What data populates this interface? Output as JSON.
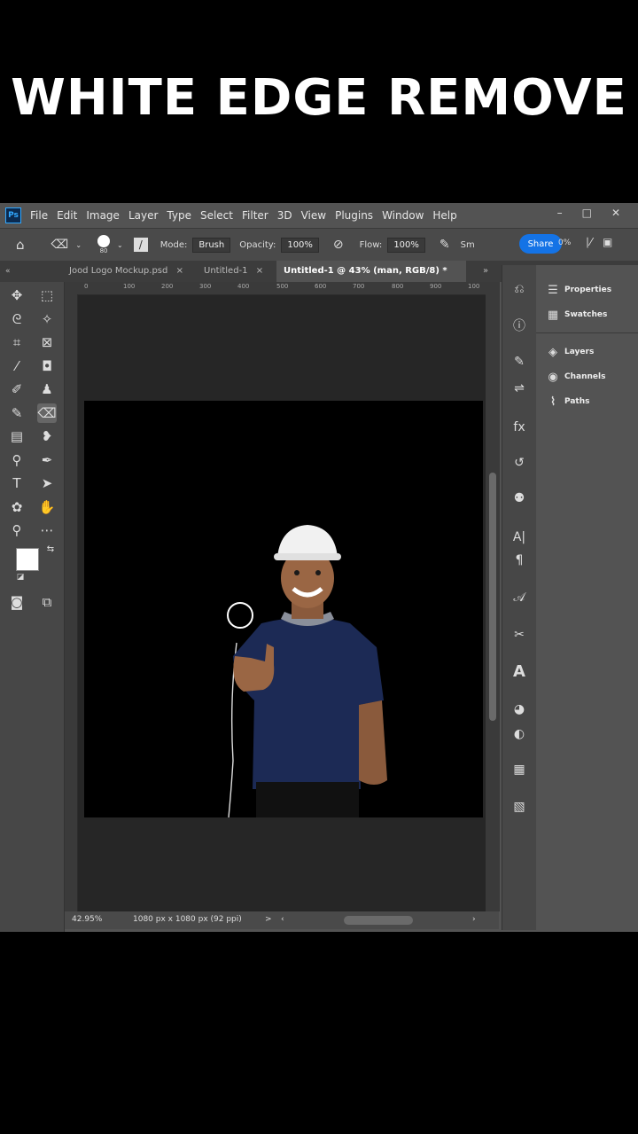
{
  "headline": "WHITE EDGE REMOVE",
  "app": {
    "logo": "Ps",
    "menu": [
      "File",
      "Edit",
      "Image",
      "Layer",
      "Type",
      "Select",
      "Filter",
      "3D",
      "View",
      "Plugins",
      "Window",
      "Help"
    ],
    "window_controls": [
      "–",
      "□",
      "✕"
    ]
  },
  "options": {
    "brush_size": "80",
    "mode_label": "Mode:",
    "mode_value": "Brush",
    "opacity_label": "Opacity:",
    "opacity_value": "100%",
    "flow_label": "Flow:",
    "flow_value": "100%",
    "smoothing_label": "Sm",
    "smoothing_value": "0%",
    "share_label": "Share"
  },
  "tabs": [
    {
      "label": "Jood Logo Mockup.psd",
      "close": "×"
    },
    {
      "label": "Untitled-1",
      "close": "×"
    },
    {
      "label": "Untitled-1 @ 43% (man, RGB/8) *",
      "close": "×"
    }
  ],
  "tab_overflow": "»",
  "ruler_ticks": [
    "0",
    "100",
    "200",
    "300",
    "400",
    "500",
    "600",
    "700",
    "800",
    "900",
    "100"
  ],
  "status": {
    "zoom": "42.95%",
    "doc_info": "1080 px x 1080 px (92 ppi)",
    "arrow": ">"
  },
  "panels": [
    {
      "label": "Properties",
      "icon": "properties-icon"
    },
    {
      "label": "Swatches",
      "icon": "swatches-icon"
    },
    {
      "label": "Layers",
      "icon": "layers-icon"
    },
    {
      "label": "Channels",
      "icon": "channels-icon"
    },
    {
      "label": "Paths",
      "icon": "paths-icon"
    }
  ],
  "colors": {
    "foreground": "#ffffff",
    "background": "#0f1a33",
    "accent": "#1473e6"
  }
}
